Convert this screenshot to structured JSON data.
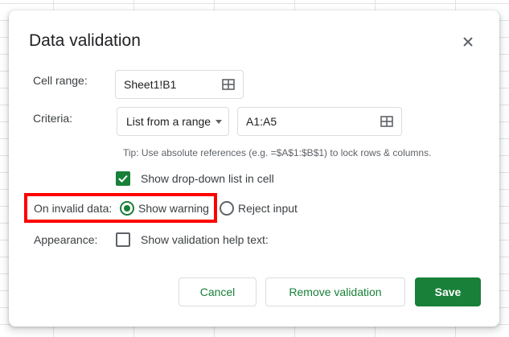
{
  "dialog": {
    "title": "Data validation",
    "close_icon": "close-icon"
  },
  "cell_range": {
    "label": "Cell range:",
    "value": "Sheet1!B1",
    "icon": "grid-select-icon"
  },
  "criteria": {
    "label": "Criteria:",
    "type_selected": "List from a range",
    "range_value": "A1:A5",
    "icon": "grid-select-icon",
    "tip": "Tip: Use absolute references (e.g. =$A$1:$B$1) to lock rows & columns."
  },
  "dropdown_option": {
    "label": "Show drop-down list in cell",
    "checked": true
  },
  "invalid_data": {
    "label": "On invalid data:",
    "options": [
      {
        "label": "Show warning",
        "selected": true
      },
      {
        "label": "Reject input",
        "selected": false
      }
    ]
  },
  "appearance": {
    "label": "Appearance:",
    "help_text_label": "Show validation help text:",
    "checked": false
  },
  "buttons": {
    "cancel": "Cancel",
    "remove": "Remove validation",
    "save": "Save"
  },
  "colors": {
    "accent": "#188038",
    "highlight": "#ff0000"
  }
}
